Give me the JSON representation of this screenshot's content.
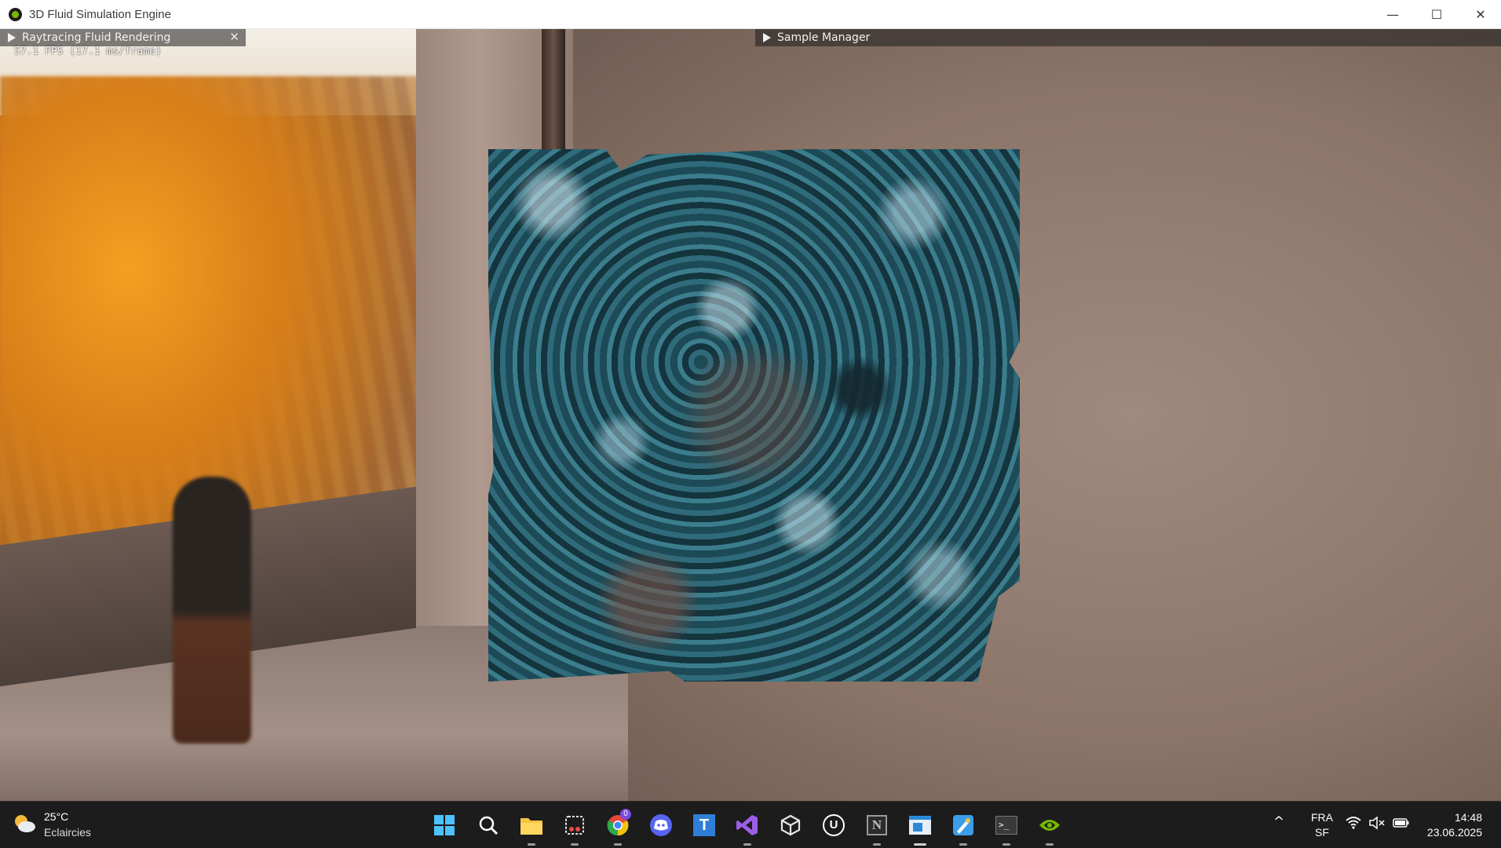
{
  "window": {
    "title": "3D Fluid Simulation Engine",
    "minimize_glyph": "—",
    "maximize_glyph": "☐",
    "close_glyph": "✕"
  },
  "overlay": {
    "render_panel": {
      "title": "Raytracing Fluid Rendering",
      "close_glyph": "✕",
      "fps_text": "57.1 FPS (17.1 ms/frame)"
    },
    "sample_panel": {
      "title": "Sample Manager"
    }
  },
  "taskbar": {
    "weather": {
      "temperature": "25°C",
      "description": "Eclaircies"
    },
    "apps": [
      {
        "name": "start",
        "label": ""
      },
      {
        "name": "search",
        "label": ""
      },
      {
        "name": "file-explorer",
        "label": ""
      },
      {
        "name": "snipping-tool",
        "label": ""
      },
      {
        "name": "chrome",
        "label": "0"
      },
      {
        "name": "discord",
        "label": ""
      },
      {
        "name": "typora",
        "label": "T"
      },
      {
        "name": "visual-studio",
        "label": ""
      },
      {
        "name": "unity",
        "label": ""
      },
      {
        "name": "unreal-engine",
        "label": "U"
      },
      {
        "name": "notion",
        "label": "N"
      },
      {
        "name": "app-window",
        "label": ""
      },
      {
        "name": "paint",
        "label": ""
      },
      {
        "name": "terminal",
        "label": ">_"
      },
      {
        "name": "nvidia",
        "label": ""
      }
    ],
    "system": {
      "language_top": "FRA",
      "language_bottom": "SF",
      "time": "14:48",
      "date": "23.06.2025",
      "chevron_glyph": "^"
    }
  },
  "colors": {
    "nvidia_green": "#76b900",
    "taskbar_bg": "#1c1c1c",
    "fluid_teal": "#1f4d5a"
  }
}
